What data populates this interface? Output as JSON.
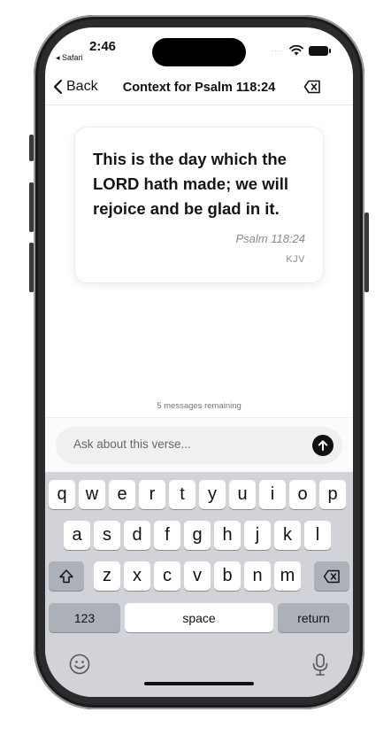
{
  "status_bar": {
    "time": "2:46",
    "back_app": "◂ Safari",
    "signal_dots": "····"
  },
  "nav": {
    "back_label": "Back",
    "title": "Context for Psalm 118:24"
  },
  "verse": {
    "text": "This is the day which the LORD hath made; we will rejoice and be glad in it.",
    "reference": "Psalm 118:24",
    "translation": "KJV"
  },
  "chat": {
    "remaining": "5 messages remaining",
    "placeholder": "Ask about this verse..."
  },
  "keyboard": {
    "row1": [
      "q",
      "w",
      "e",
      "r",
      "t",
      "y",
      "u",
      "i",
      "o",
      "p"
    ],
    "row2": [
      "a",
      "s",
      "d",
      "f",
      "g",
      "h",
      "j",
      "k",
      "l"
    ],
    "row3": [
      "z",
      "x",
      "c",
      "v",
      "b",
      "n",
      "m"
    ],
    "numbers_label": "123",
    "space_label": "space",
    "return_label": "return"
  },
  "colors": {
    "keyboard_bg": "#d1d3d9",
    "key": "#ffffff",
    "key_dark": "#acb0b9",
    "send": "#111111"
  }
}
